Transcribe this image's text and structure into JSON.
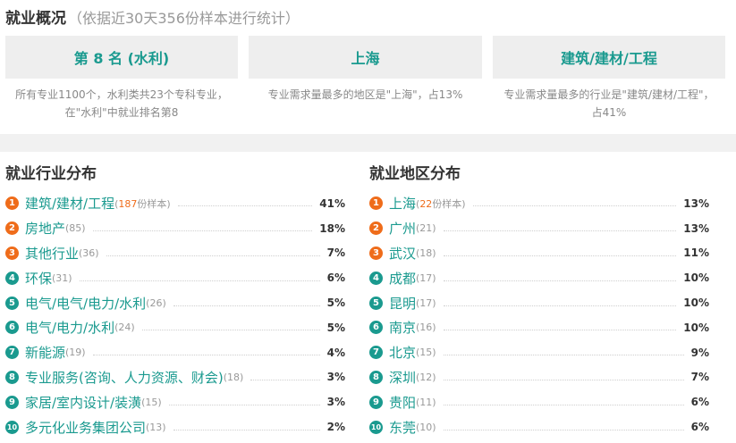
{
  "header": {
    "title": "就业概况",
    "subtitle": "（依据近30天356份样本进行统计）"
  },
  "summary": [
    {
      "headline": "第 8 名 (水利)",
      "description": "所有专业1100个，水利类共23个专科专业，在\"水利\"中就业排名第8"
    },
    {
      "headline": "上海",
      "description": "专业需求量最多的地区是\"上海\"，占13%"
    },
    {
      "headline": "建筑/建材/工程",
      "description": "专业需求量最多的行业是\"建筑/建材/工程\"，占41%"
    }
  ],
  "industry": {
    "title": "就业行业分布",
    "first_count_prefix": "(",
    "first_count_num": "187",
    "first_count_suffix": "份样本)",
    "items": [
      {
        "rank": "1",
        "name": "建筑/建材/工程",
        "count": "(187份样本)",
        "pct": "41%"
      },
      {
        "rank": "2",
        "name": "房地产",
        "count": "(85)",
        "pct": "18%"
      },
      {
        "rank": "3",
        "name": "其他行业",
        "count": "(36)",
        "pct": "7%"
      },
      {
        "rank": "4",
        "name": "环保",
        "count": "(31)",
        "pct": "6%"
      },
      {
        "rank": "5",
        "name": "电气/电气/电力/水利",
        "count": "(26)",
        "pct": "5%"
      },
      {
        "rank": "6",
        "name": "电气/电力/水利",
        "count": "(24)",
        "pct": "5%"
      },
      {
        "rank": "7",
        "name": "新能源",
        "count": "(19)",
        "pct": "4%"
      },
      {
        "rank": "8",
        "name": "专业服务(咨询、人力资源、财会)",
        "count": "(18)",
        "pct": "3%"
      },
      {
        "rank": "9",
        "name": "家居/室内设计/装潢",
        "count": "(15)",
        "pct": "3%"
      },
      {
        "rank": "10",
        "name": "多元化业务集团公司",
        "count": "(13)",
        "pct": "2%"
      }
    ]
  },
  "region": {
    "title": "就业地区分布",
    "first_count_prefix": "(",
    "first_count_num": "22",
    "first_count_suffix": "份样本)",
    "items": [
      {
        "rank": "1",
        "name": "上海",
        "count": "(22份样本)",
        "pct": "13%"
      },
      {
        "rank": "2",
        "name": "广州",
        "count": "(21)",
        "pct": "13%"
      },
      {
        "rank": "3",
        "name": "武汉",
        "count": "(18)",
        "pct": "11%"
      },
      {
        "rank": "4",
        "name": "成都",
        "count": "(17)",
        "pct": "10%"
      },
      {
        "rank": "5",
        "name": "昆明",
        "count": "(17)",
        "pct": "10%"
      },
      {
        "rank": "6",
        "name": "南京",
        "count": "(16)",
        "pct": "10%"
      },
      {
        "rank": "7",
        "name": "北京",
        "count": "(15)",
        "pct": "9%"
      },
      {
        "rank": "8",
        "name": "深圳",
        "count": "(12)",
        "pct": "7%"
      },
      {
        "rank": "9",
        "name": "贵阳",
        "count": "(11)",
        "pct": "6%"
      },
      {
        "rank": "10",
        "name": "东莞",
        "count": "(10)",
        "pct": "6%"
      }
    ]
  },
  "colors": {
    "accent": "#1a9a8f",
    "top_badge": "#ef6c1a",
    "card_bg": "#eeeeee"
  }
}
